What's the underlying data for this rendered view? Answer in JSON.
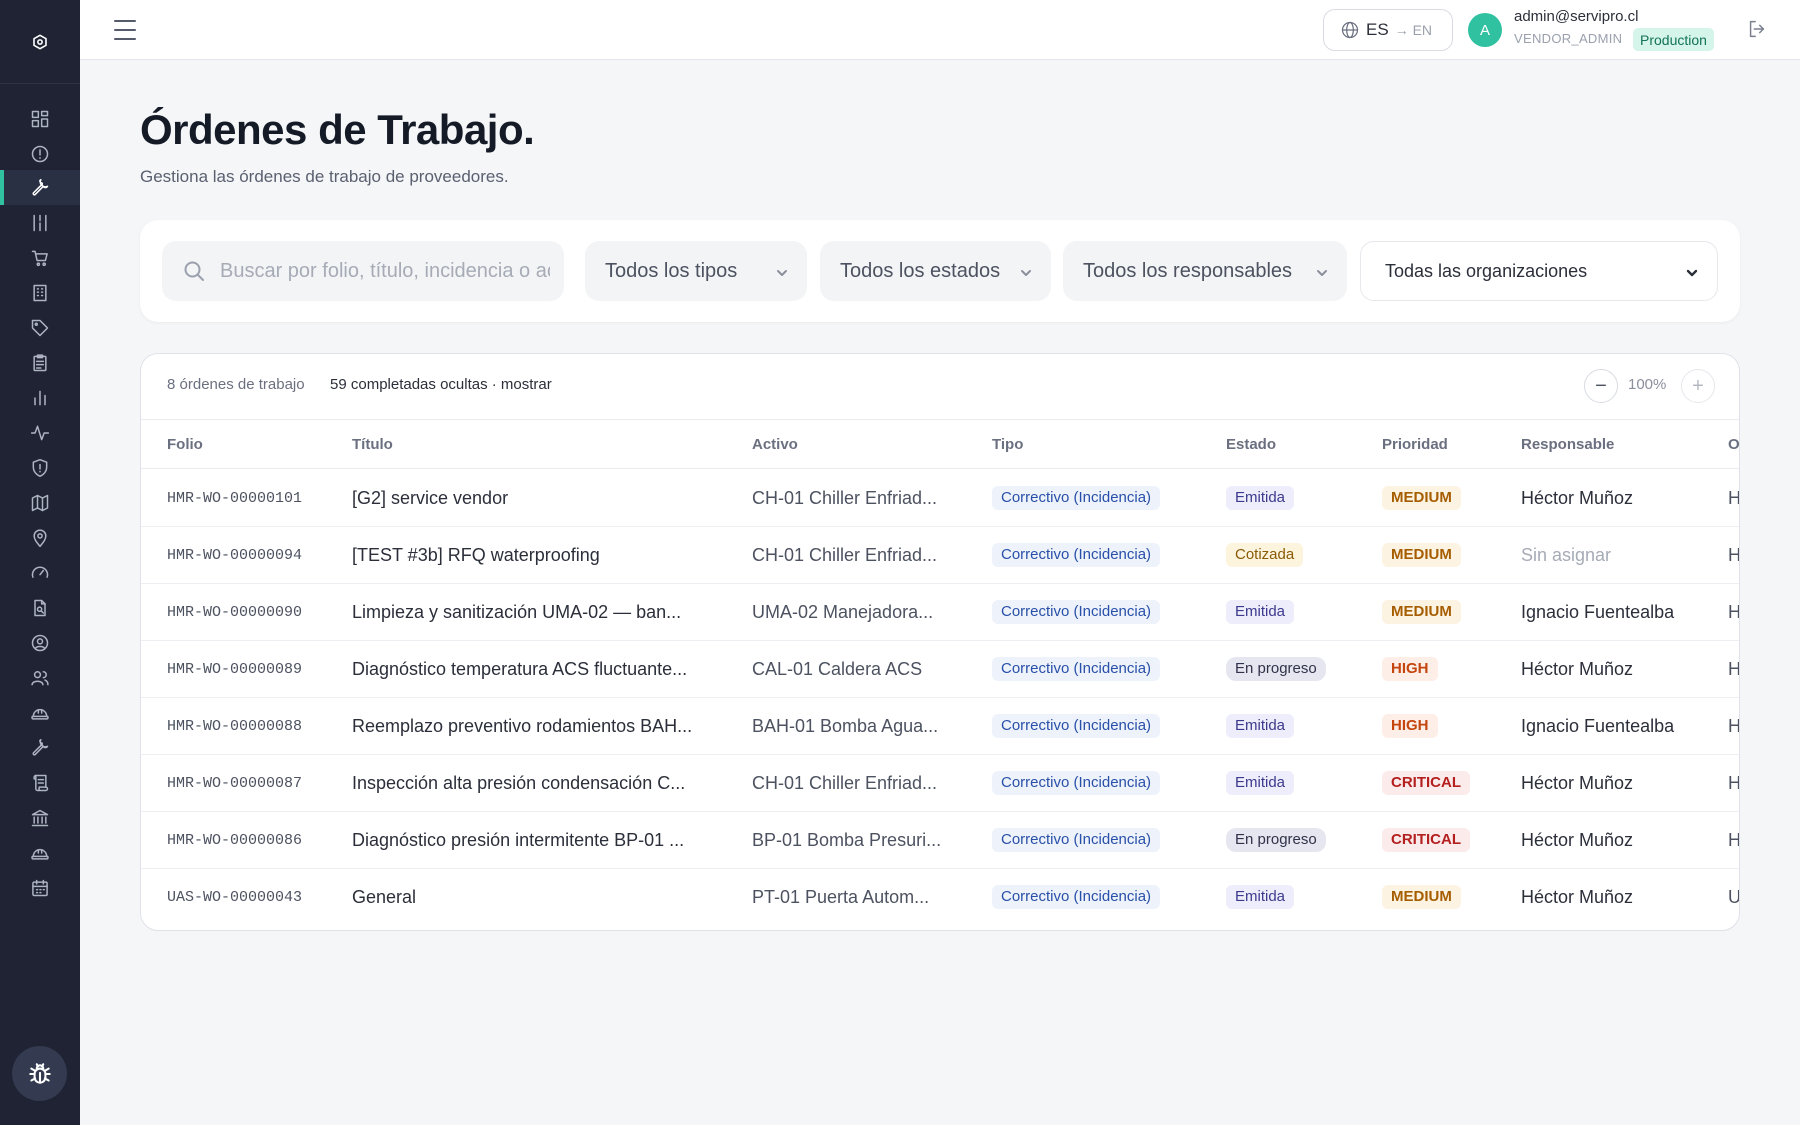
{
  "header": {
    "lang_current": "ES",
    "lang_other": "→ EN",
    "user_initial": "A",
    "user_email": "admin@servipro.cl",
    "user_role": "VENDOR_ADMIN",
    "environment": "Production"
  },
  "sidebar": {
    "items": [
      {
        "icon": "dashboard-icon"
      },
      {
        "icon": "alert-icon"
      },
      {
        "icon": "wrench-icon",
        "active": true
      },
      {
        "icon": "tools-icon"
      },
      {
        "icon": "cart-icon"
      },
      {
        "icon": "building-icon"
      },
      {
        "icon": "tag-icon"
      },
      {
        "icon": "clipboard-icon"
      },
      {
        "icon": "chart-icon"
      },
      {
        "icon": "activity-icon"
      },
      {
        "icon": "shield-icon"
      },
      {
        "icon": "map-icon"
      },
      {
        "icon": "location-icon"
      },
      {
        "icon": "gauge-icon"
      },
      {
        "icon": "file-search-icon"
      },
      {
        "icon": "user-circle-icon"
      },
      {
        "icon": "users-icon"
      },
      {
        "icon": "hardhat-icon"
      },
      {
        "icon": "wrench-icon"
      },
      {
        "icon": "scroll-icon"
      },
      {
        "icon": "bank-icon"
      },
      {
        "icon": "hardhat-icon"
      },
      {
        "icon": "calendar-icon"
      }
    ]
  },
  "page": {
    "title": "Órdenes de Trabajo.",
    "subtitle": "Gestiona las órdenes de trabajo de proveedores."
  },
  "filters": {
    "search_placeholder": "Buscar por folio, título, incidencia o activo",
    "type": "Todos los tipos",
    "status": "Todos los estados",
    "assignee": "Todos los responsables",
    "organization": "Todas las organizaciones"
  },
  "table": {
    "count_label": "8 órdenes de trabajo",
    "hidden_label": "59 completadas ocultas · mostrar",
    "zoom_out": "−",
    "zoom": "100%",
    "zoom_in": "+",
    "columns": [
      "Folio",
      "Título",
      "Activo",
      "Tipo",
      "Estado",
      "Prioridad",
      "Responsable",
      "O"
    ],
    "rows": [
      {
        "folio": "HMR-WO-00000101",
        "titulo": "[G2] service vendor",
        "activo": "CH-01 Chiller Enfriad...",
        "tipo": "Correctivo (Incidencia)",
        "estado": "Emitida",
        "prioridad": "MEDIUM",
        "responsable": "Héctor Muñoz",
        "org": "H"
      },
      {
        "folio": "HMR-WO-00000094",
        "titulo": "[TEST #3b] RFQ waterproofing",
        "activo": "CH-01 Chiller Enfriad...",
        "tipo": "Correctivo (Incidencia)",
        "estado": "Cotizada",
        "prioridad": "MEDIUM",
        "responsable": "Sin asignar",
        "org": "H"
      },
      {
        "folio": "HMR-WO-00000090",
        "titulo": "Limpieza y sanitización UMA-02 — ban...",
        "activo": "UMA-02 Manejadora...",
        "tipo": "Correctivo (Incidencia)",
        "estado": "Emitida",
        "prioridad": "MEDIUM",
        "responsable": "Ignacio Fuentealba",
        "org": "H"
      },
      {
        "folio": "HMR-WO-00000089",
        "titulo": "Diagnóstico temperatura ACS fluctuante...",
        "activo": "CAL-01 Caldera ACS",
        "tipo": "Correctivo (Incidencia)",
        "estado": "En progreso",
        "prioridad": "HIGH",
        "responsable": "Héctor Muñoz",
        "org": "H"
      },
      {
        "folio": "HMR-WO-00000088",
        "titulo": "Reemplazo preventivo rodamientos BAH...",
        "activo": "BAH-01 Bomba Agua...",
        "tipo": "Correctivo (Incidencia)",
        "estado": "Emitida",
        "prioridad": "HIGH",
        "responsable": "Ignacio Fuentealba",
        "org": "H"
      },
      {
        "folio": "HMR-WO-00000087",
        "titulo": "Inspección alta presión condensación C...",
        "activo": "CH-01 Chiller Enfriad...",
        "tipo": "Correctivo (Incidencia)",
        "estado": "Emitida",
        "prioridad": "CRITICAL",
        "responsable": "Héctor Muñoz",
        "org": "H"
      },
      {
        "folio": "HMR-WO-00000086",
        "titulo": "Diagnóstico presión intermitente BP-01 ...",
        "activo": "BP-01 Bomba Presuri...",
        "tipo": "Correctivo (Incidencia)",
        "estado": "En progreso",
        "prioridad": "CRITICAL",
        "responsable": "Héctor Muñoz",
        "org": "H"
      },
      {
        "folio": "UAS-WO-00000043",
        "titulo": "General",
        "activo": "PT-01 Puerta Autom...",
        "tipo": "Correctivo (Incidencia)",
        "estado": "Emitida",
        "prioridad": "MEDIUM",
        "responsable": "Héctor Muñoz",
        "org": "U"
      }
    ]
  },
  "colors": {
    "sidebar_bg": "#1f2333",
    "accent": "#2fc1a0",
    "priority_medium": "#a65d00",
    "priority_high": "#c4450d",
    "priority_critical": "#b41f1f"
  }
}
